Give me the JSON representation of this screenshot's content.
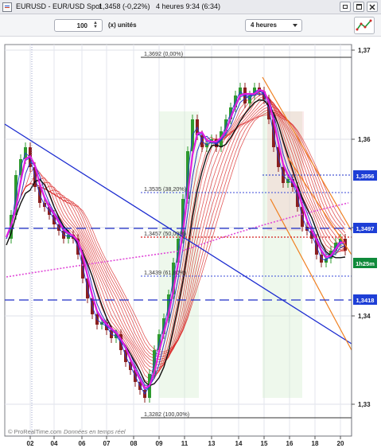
{
  "window": {
    "instrument": "EURUSD - EUR/USD Spot",
    "price": "1,3458 (-0,22%)",
    "timeframe_info": "4 heures  9:34 (6:34)"
  },
  "toolbar": {
    "units_value": "100",
    "units_label": "(x) unités",
    "period_value": "4 heures"
  },
  "chart": {
    "price_axis_labels": [
      "1,37",
      "1,36",
      "1,35",
      "1,34",
      "1,33"
    ],
    "date_axis_labels": [
      "02",
      "04",
      "06",
      "07",
      "08",
      "09",
      "11",
      "13",
      "14",
      "15",
      "16",
      "18",
      "20"
    ],
    "fib_labels": [
      "1,3692 (0,00%)",
      "1,3535 (38,20%)",
      "1,3457 (50,00%)",
      "1,3439 (61,80%)",
      "1,3282 (100,00%)"
    ],
    "tags": [
      {
        "text": "1,3556",
        "color": "#1e3fd6"
      },
      {
        "text": "1,3497",
        "color": "#1e3fd6"
      },
      {
        "text": "1h25m",
        "color": "#0f8a3a"
      },
      {
        "text": "1,3418",
        "color": "#1e3fd6"
      }
    ],
    "watermark": "© ProRealTime.com",
    "watermark_note": "Données en temps réel"
  },
  "colors": {
    "up_candle": "#2e9a2e",
    "down_candle": "#8a1f1f",
    "trendline": "#1a2ad0",
    "fib": "#333333",
    "magenta": "#e01ce0",
    "orange": "#f08020",
    "red_band": "#d82020"
  }
}
